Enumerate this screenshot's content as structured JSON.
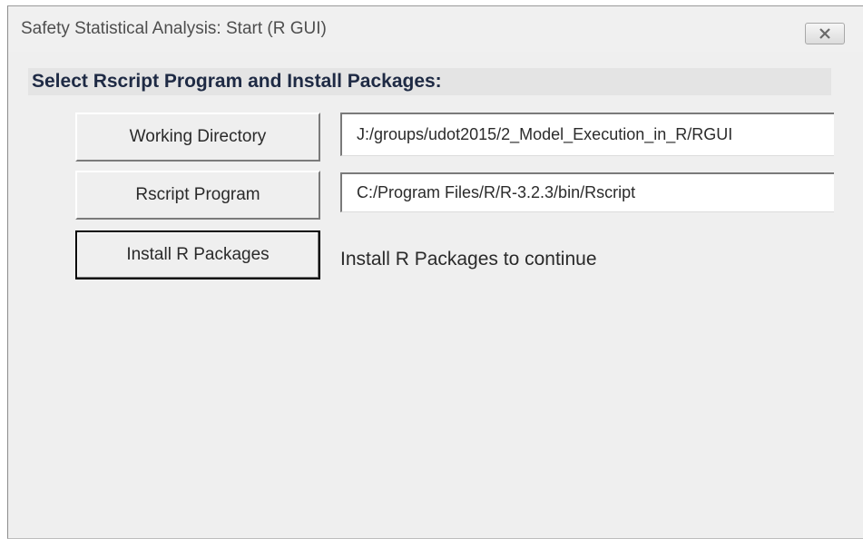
{
  "window": {
    "title": "Safety Statistical Analysis: Start (R GUI)",
    "close_icon": "close-icon"
  },
  "section": {
    "header": "Select Rscript Program and Install Packages:"
  },
  "buttons": {
    "working_directory": "Working Directory",
    "rscript_program": "Rscript Program",
    "install_packages": "Install R Packages"
  },
  "fields": {
    "working_directory_value": "J:/groups/udot2015/2_Model_Execution_in_R/RGUI",
    "rscript_program_value": "C:/Program Files/R/R-3.2.3/bin/Rscript"
  },
  "status": {
    "message": "Install R Packages to continue"
  },
  "colors": {
    "header_text": "#1e2a44",
    "window_background": "#efefef",
    "header_band": "#e4e4e4"
  }
}
